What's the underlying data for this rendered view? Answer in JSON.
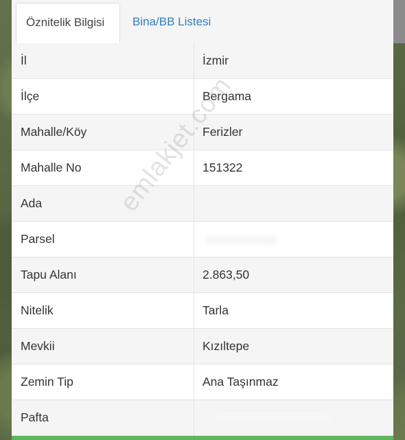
{
  "tabs": [
    {
      "label": "Öznitelik Bilgisi",
      "active": true
    },
    {
      "label": "Bina/BB Listesi",
      "active": false
    }
  ],
  "rows": [
    {
      "label": "İl",
      "value": "İzmir"
    },
    {
      "label": "İlçe",
      "value": "Bergama"
    },
    {
      "label": "Mahalle/Köy",
      "value": "Ferizler"
    },
    {
      "label": "Mahalle No",
      "value": "151322"
    },
    {
      "label": "Ada",
      "value": ""
    },
    {
      "label": "Parsel",
      "value": ""
    },
    {
      "label": "Tapu Alanı",
      "value": "2.863,50"
    },
    {
      "label": "Nitelik",
      "value": "Tarla"
    },
    {
      "label": "Mevkii",
      "value": "Kızıltepe"
    },
    {
      "label": "Zemin Tip",
      "value": "Ana Taşınmaz"
    },
    {
      "label": "Pafta",
      "value": ""
    }
  ],
  "watermark": "emlakjet.com",
  "colors": {
    "tab_link": "#2f7dc0",
    "bottom_bar": "#5cb85c"
  }
}
